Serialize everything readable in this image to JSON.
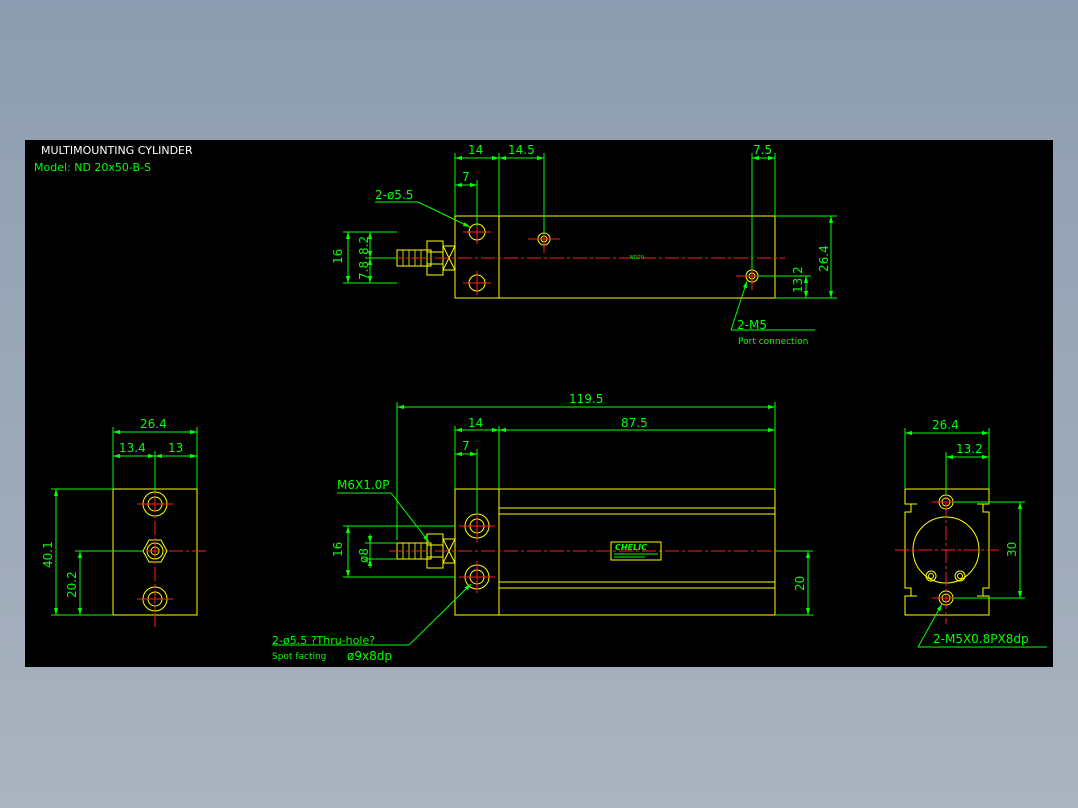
{
  "title_block": {
    "title": "MULTIMOUNTING CYLINDER",
    "model": "Model: ND 20x50-B-S"
  },
  "top_view": {
    "dim_14": "14",
    "dim_14_5": "14.5",
    "dim_7": "7",
    "dim_7_5": "7.5",
    "hole_note": "2-ø5.5",
    "dim_16": "16",
    "dim_7_8": "7.8",
    "dim_8_2": "8.2",
    "dim_26_4": "26.4",
    "dim_13_2": "13.2",
    "port_note": "2-M5",
    "port_desc": "Port connection"
  },
  "front_view": {
    "dim_119_5": "119.5",
    "dim_14": "14",
    "dim_87_5": "87.5",
    "dim_7": "7",
    "thread_note": "M6X1.0P",
    "dim_16": "16",
    "dim_phi8": "ø8",
    "dim_20": "20",
    "hole_note": "2-ø5.5 ?Thru-hole?",
    "spot_note": "Spot facting",
    "spot_dim": "ø9x8dp",
    "brand": "CHELIC"
  },
  "left_view": {
    "dim_26_4": "26.4",
    "dim_13_4": "13.4",
    "dim_13": "13",
    "dim_40_1": "40.1",
    "dim_20_2": "20.2"
  },
  "right_view": {
    "dim_26_4": "26.4",
    "dim_13_2": "13.2",
    "dim_30": "30",
    "tap_note": "2-M5X0.8PX8dp"
  },
  "colors": {
    "object": "#ffff00",
    "dimension": "#00ff00",
    "centerline": "#ff2020",
    "text": "#ffffff",
    "background": "#000000"
  }
}
